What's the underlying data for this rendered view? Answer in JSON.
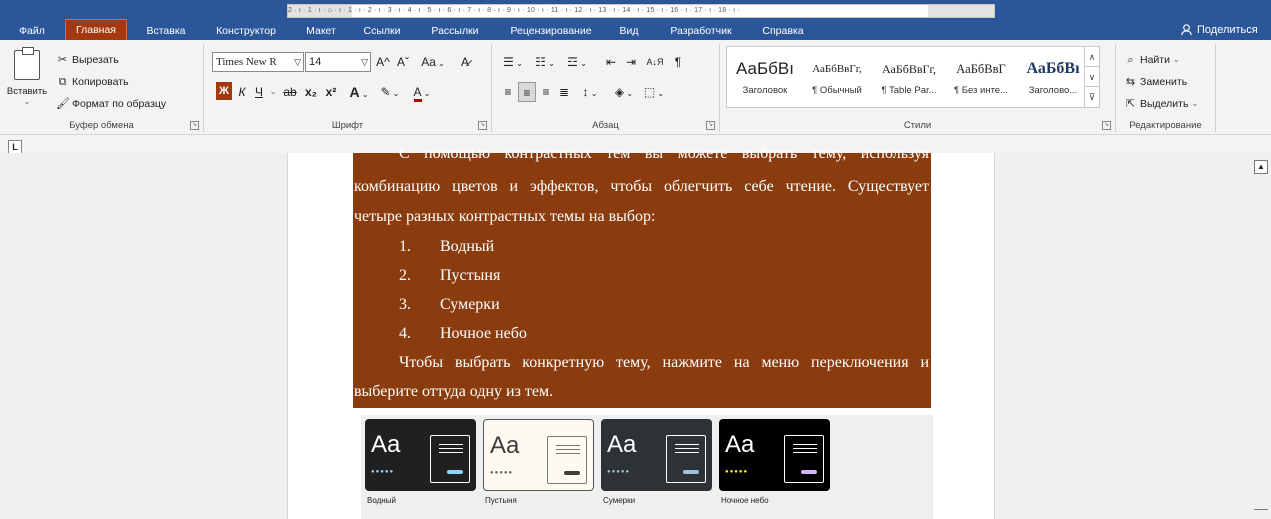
{
  "tabs": [
    "Файл",
    "Главная",
    "Вставка",
    "Конструктор",
    "Макет",
    "Ссылки",
    "Рассылки",
    "Рецензирование",
    "Вид",
    "Разработчик",
    "Справка"
  ],
  "share_label": "Поделиться",
  "clipboard": {
    "paste": "Вставить",
    "cut": "Вырезать",
    "copy": "Копировать",
    "format_painter": "Формат по образцу",
    "label": "Буфер обмена"
  },
  "font": {
    "name": "Times New R",
    "size": "14",
    "label": "Шрифт",
    "case_btn": "Aa",
    "bold": "Ж",
    "italic": "К",
    "underline": "Ч",
    "strike": "ab",
    "subscript": "x₂",
    "superscript": "x²",
    "grow": "A^",
    "shrink": "Aˇ"
  },
  "paragraph": {
    "label": "Абзац",
    "sort": "А↓Я",
    "pilcrow": "¶"
  },
  "styles": {
    "label": "Стили",
    "items": [
      {
        "preview": "АаБбВı",
        "name": "Заголовок"
      },
      {
        "preview": "АаБбВвГг,",
        "name": "¶ Обычный"
      },
      {
        "preview": "АаБбВвГг,",
        "name": "¶ Table Par..."
      },
      {
        "preview": "АаБбВвГ",
        "name": "¶ Без инте..."
      },
      {
        "preview": "АаБбВı",
        "name": "Заголово..."
      }
    ]
  },
  "editing": {
    "label": "Редактирование",
    "find": "Найти",
    "replace": "Заменить",
    "select": "Выделить"
  },
  "ruler_scale": "2 · ı · 1 · ı · ⌂ · ı · 1 · ı · 2 · ı · 3 · ı · 4 · ı · 5 · ı · 6 · ı · 7 · ı · 8 · ı · 9 · ı · 10 · ı · 11 · ı · 12 · ı · 13 · ı · 14 · ı · 15 · ı · 16 · ı · 17 · ı · 18 · ı ·",
  "document": {
    "line1": "С помощью контрастных тем вы можете выбрать тему, используя",
    "line2": "комбинацию цветов и эффектов, чтобы облегчить себе чтение. Существует",
    "line3": "четыре разных контрастных темы на выбор:",
    "list": [
      {
        "num": "1.",
        "text": "Водный"
      },
      {
        "num": "2.",
        "text": "Пустыня"
      },
      {
        "num": "3.",
        "text": "Сумерки"
      },
      {
        "num": "4.",
        "text": "Ночное небо"
      }
    ],
    "line4": "Чтобы выбрать конкретную тему, нажмите на меню переключения и",
    "line5": "выберите оттуда одну из тем."
  },
  "themes": [
    {
      "name": "Водный",
      "aa": "Aa",
      "dots": "●●●●●"
    },
    {
      "name": "Пустыня",
      "aa": "Aa",
      "dots": "●●●●●"
    },
    {
      "name": "Сумерки",
      "aa": "Aa",
      "dots": "●●●●●"
    },
    {
      "name": "Ночное небо",
      "aa": "Aa",
      "dots": "●●●●●"
    }
  ],
  "colors": {
    "title_bar": "#2b579a",
    "active_tab": "#a4380e",
    "highlight": "#8a3c0f"
  }
}
